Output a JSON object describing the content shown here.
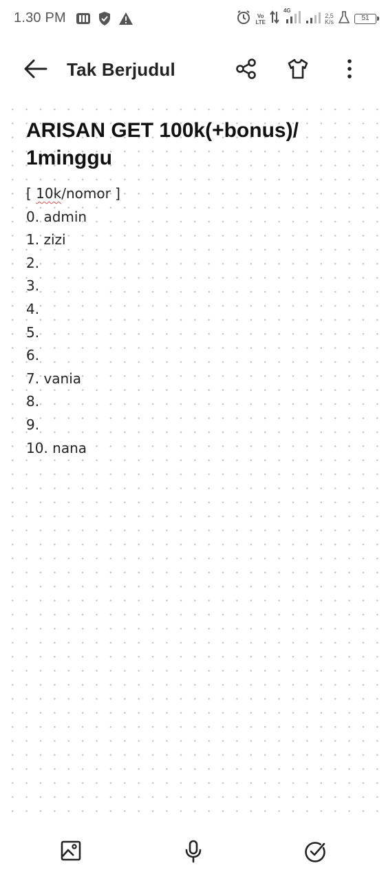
{
  "status_bar": {
    "time": "1.30 PM",
    "network_top": "Vo",
    "network_bottom": "LTE",
    "network_gen": "4G",
    "speed_value": "2,5",
    "speed_unit": "K/s",
    "battery": "51",
    "icons": [
      "message-icon",
      "shield-icon",
      "warning-icon",
      "alarm-icon",
      "data-arrows-icon",
      "signal-icon",
      "signal-icon",
      "flask-icon",
      "battery-icon"
    ]
  },
  "app_bar": {
    "title": "Tak Berjudul",
    "icons": [
      "back-arrow-icon",
      "share-icon",
      "shirt-icon",
      "more-vert-icon"
    ]
  },
  "note": {
    "title": "ARISAN GET 100k(+bonus)/ 1minggu",
    "header_line": {
      "prefix": "[ ",
      "misspelled": "10k",
      "suffix": "/nomor ]"
    },
    "lines": [
      "0. admin",
      "1. zizi",
      "2.",
      "3.",
      "4.",
      "5.",
      "6.",
      "7. vania",
      "8.",
      "9.",
      "10. nana"
    ]
  },
  "bottom_bar": {
    "icons": [
      "image-icon",
      "microphone-icon",
      "check-circle-icon"
    ]
  },
  "colors": {
    "background": "#ffffff",
    "dot_grid": "#c4c4c4",
    "text": "#1f1f1f",
    "spellcheck": "#d9534f"
  }
}
